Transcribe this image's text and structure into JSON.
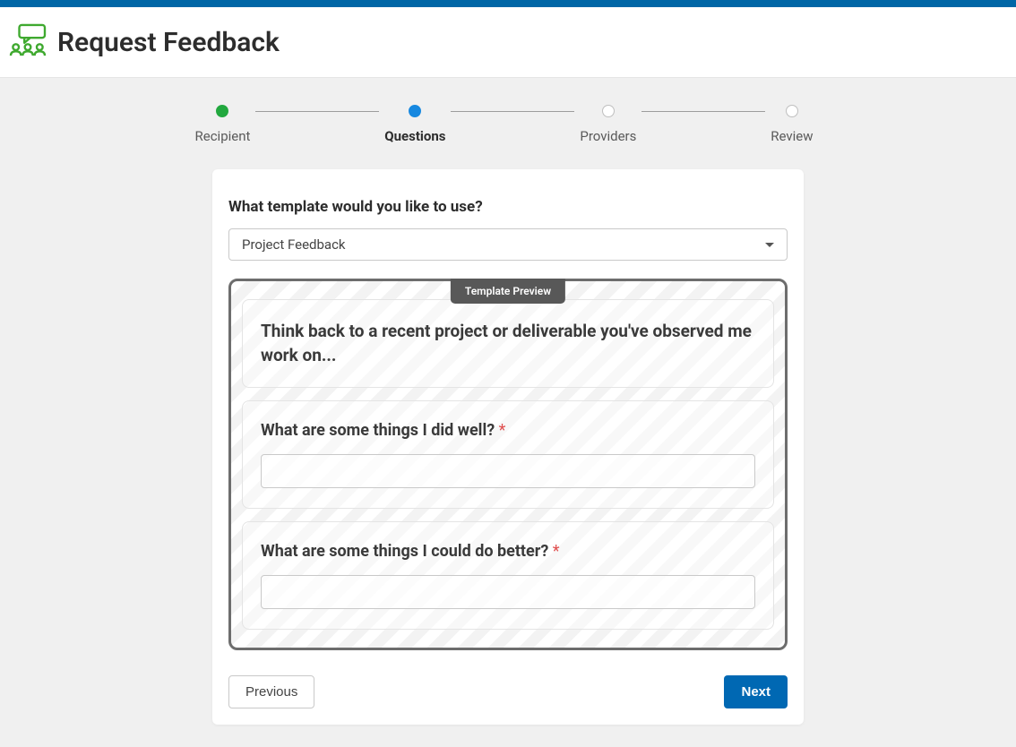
{
  "header": {
    "title": "Request Feedback"
  },
  "stepper": {
    "steps": [
      {
        "label": "Recipient",
        "state": "completed"
      },
      {
        "label": "Questions",
        "state": "active"
      },
      {
        "label": "Providers",
        "state": "pending"
      },
      {
        "label": "Review",
        "state": "pending"
      }
    ]
  },
  "template_section": {
    "label": "What template would you like to use?",
    "selected": "Project Feedback"
  },
  "preview": {
    "tab_label": "Template Preview",
    "intro": "Think back to a recent project or deliverable you've observed me work on...",
    "questions": [
      {
        "text": "What are some things I did well?",
        "required": true
      },
      {
        "text": "What are some things I could do better?",
        "required": true
      }
    ]
  },
  "footer": {
    "prev": "Previous",
    "next": "Next"
  }
}
